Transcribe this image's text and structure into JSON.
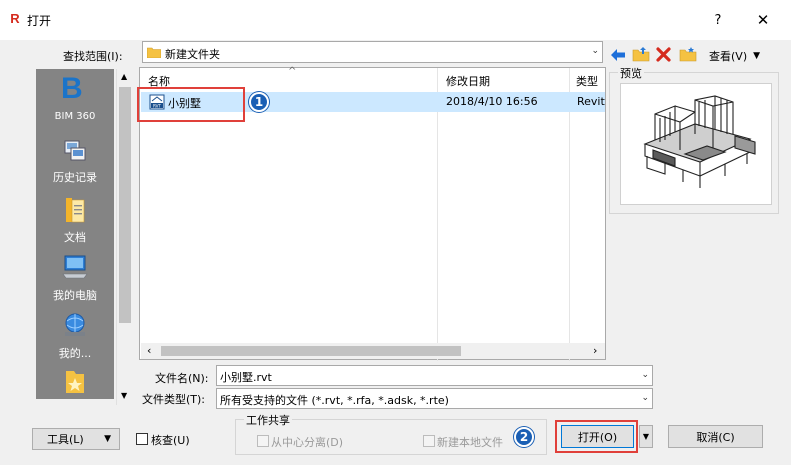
{
  "window": {
    "title": "打开",
    "app_icon_letter": "R",
    "app_icon_color": "#d52b1e",
    "help_label": "?",
    "close_label": "✕"
  },
  "lookin": {
    "label": "查找范围(I):",
    "value": "新建文件夹"
  },
  "toolbar": {
    "view_label": "查看(V)"
  },
  "places": [
    {
      "label": "BIM 360",
      "icon": "bim360-icon"
    },
    {
      "label": "历史记录",
      "icon": "history-icon"
    },
    {
      "label": "文档",
      "icon": "documents-icon"
    },
    {
      "label": "我的电脑",
      "icon": "computer-icon"
    },
    {
      "label": "我的...",
      "icon": "network-icon"
    }
  ],
  "filelist": {
    "columns": [
      "名称",
      "修改日期",
      "类型"
    ],
    "rows": [
      {
        "name": "小别墅",
        "modified": "2018/4/10 16:56",
        "type": "Revit"
      }
    ]
  },
  "preview": {
    "label": "预览"
  },
  "filename": {
    "label": "文件名(N):",
    "value": "小别墅.rvt"
  },
  "filetype": {
    "label": "文件类型(T):",
    "value": "所有受支持的文件 (*.rvt, *.rfa, *.adsk, *.rte)"
  },
  "worksharing": {
    "group_label": "工作共享",
    "detach_label": "从中心分离(D)",
    "new_local_label": "新建本地文件"
  },
  "buttons": {
    "tools_label": "工具(L)",
    "audit_label": "核查(U)",
    "open_label": "打开(O)",
    "cancel_label": "取消(C)"
  },
  "annotations": {
    "badge1": "1",
    "badge2": "2",
    "highlight_color": "#e0403a",
    "badge_color": "#1a5fb4"
  },
  "colors": {
    "selection": "#cce8ff",
    "places_bg": "#848484",
    "folder": "#f5c242"
  }
}
